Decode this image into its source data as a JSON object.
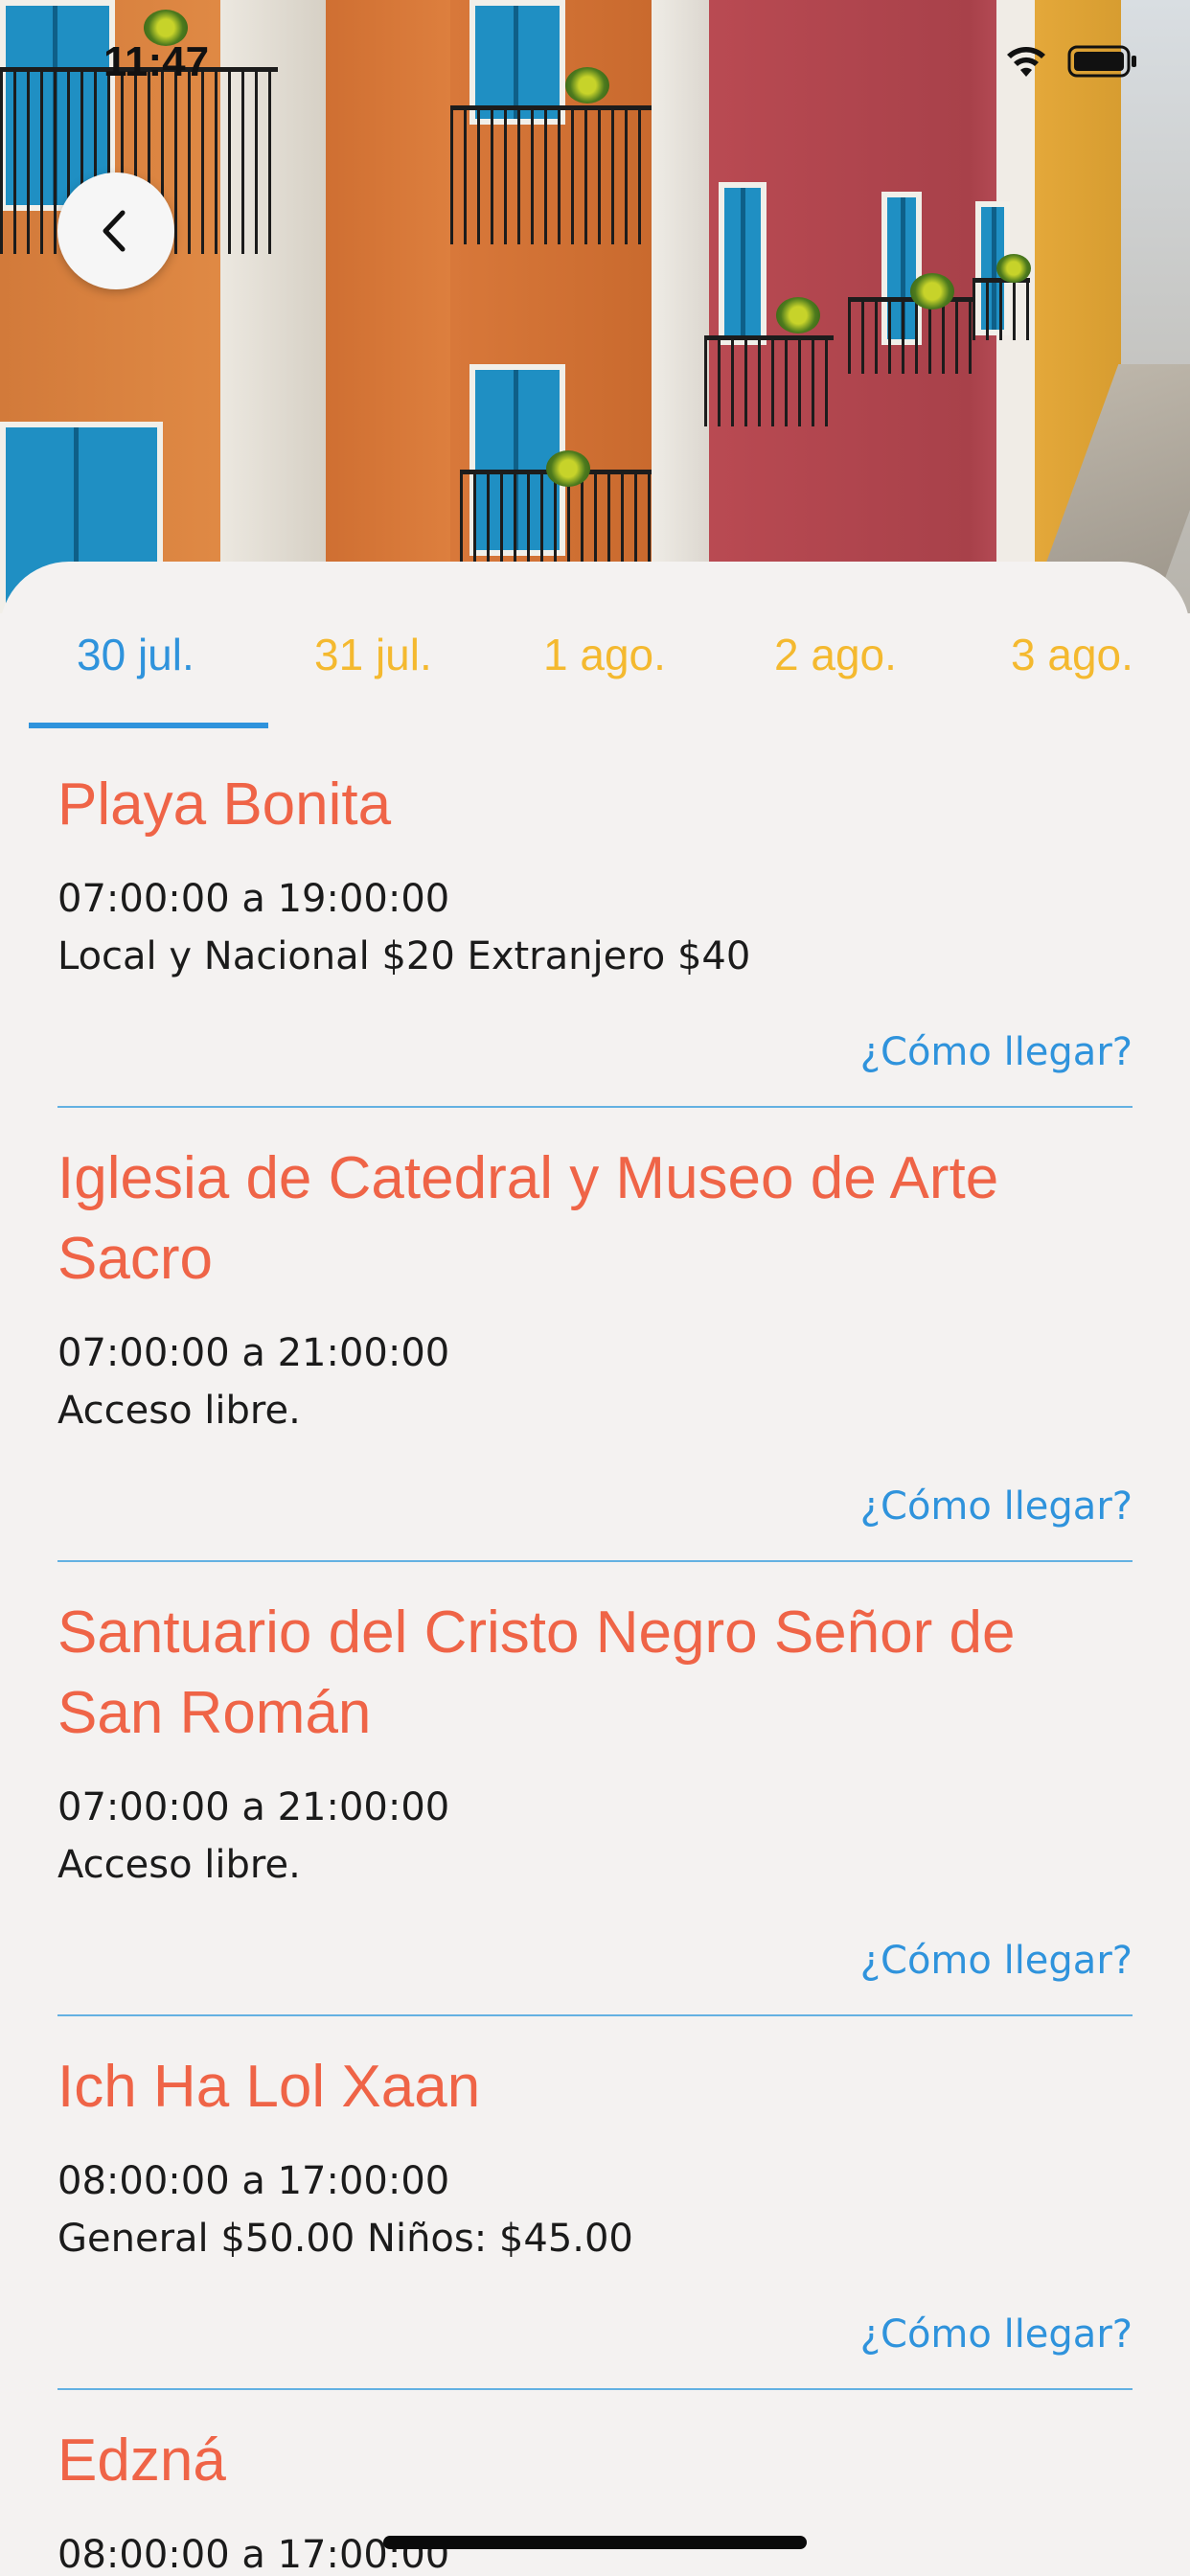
{
  "status_bar": {
    "time": "11:47"
  },
  "hero": {
    "back_icon": "chevron-left-icon"
  },
  "tabs": [
    {
      "label": "30 jul.",
      "active": true
    },
    {
      "label": "31 jul.",
      "active": false
    },
    {
      "label": "1 ago.",
      "active": false
    },
    {
      "label": "2 ago.",
      "active": false
    },
    {
      "label": "3 ago.",
      "active": false
    }
  ],
  "places": [
    {
      "name": "Playa Bonita",
      "hours": "07:00:00 a 19:00:00",
      "price": "Local y Nacional $20 Extranjero $40",
      "link": "¿Cómo llegar?"
    },
    {
      "name": "Iglesia de Catedral y Museo de Arte Sacro",
      "hours": "07:00:00 a 21:00:00",
      "price": "Acceso libre.",
      "link": "¿Cómo llegar?"
    },
    {
      "name": "Santuario del Cristo Negro Señor de San Román",
      "hours": "07:00:00 a 21:00:00",
      "price": "Acceso libre.",
      "link": "¿Cómo llegar?"
    },
    {
      "name": "Ich Ha Lol Xaan",
      "hours": "08:00:00 a 17:00:00",
      "price": "General $50.00 Niños: $45.00",
      "link": "¿Cómo llegar?"
    },
    {
      "name": "Edzná",
      "hours": "08:00:00 a 17:00:00",
      "price": "",
      "link": ""
    }
  ],
  "colors": {
    "title": "#ef6447",
    "accent": "#2f93dc",
    "tab_inactive": "#f4b92f",
    "divider": "#63b1e2"
  }
}
